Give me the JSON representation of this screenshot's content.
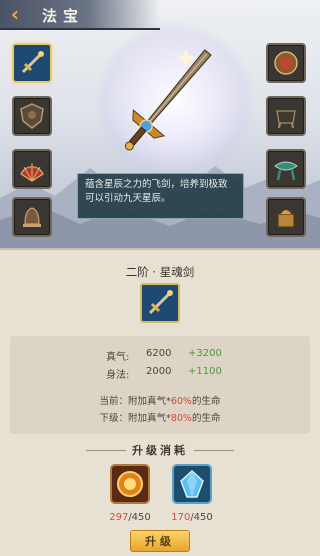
{
  "header": {
    "title": "法宝",
    "back_icon": "back-arrow-icon"
  },
  "left_slots": [
    {
      "name": "star-soul-sword",
      "icon": "sword-icon",
      "selected": true
    },
    {
      "name": "bronze-shield",
      "icon": "shield-icon",
      "selected": false
    },
    {
      "name": "red-fan",
      "icon": "fan-icon",
      "selected": false
    },
    {
      "name": "bronze-bell",
      "icon": "bell-icon",
      "selected": false
    }
  ],
  "right_slots": [
    {
      "name": "bronze-mirror",
      "icon": "mirror-icon"
    },
    {
      "name": "bronze-cauldron",
      "icon": "cauldron-icon"
    },
    {
      "name": "jade-ribbon",
      "icon": "ribbon-icon"
    },
    {
      "name": "bronze-seal",
      "icon": "seal-icon"
    }
  ],
  "description": "蕴含星辰之力的飞剑，培养到极致可以引动九天星辰。",
  "item": {
    "name": "二阶 · 星魂剑"
  },
  "stats": [
    {
      "label": "真气:",
      "value": "6200",
      "bonus": "+3200"
    },
    {
      "label": "身法:",
      "value": "2000",
      "bonus": "+1100"
    }
  ],
  "effects": {
    "current_prefix": "当前：附加真气*",
    "current_pct": "60%",
    "current_suffix": "的生命",
    "next_prefix": "下级：附加真气*",
    "next_pct": "80%",
    "next_suffix": "的生命"
  },
  "cost": {
    "title": "升级消耗",
    "materials": [
      {
        "name": "fire-orb",
        "icon": "fire-orb-icon",
        "have": "297",
        "need": "/450"
      },
      {
        "name": "blue-crystal",
        "icon": "blue-crystal-icon",
        "have": "170",
        "need": "/450"
      }
    ]
  },
  "upgrade_button": "升级",
  "colors": {
    "bonus_green": "#4c9a3e",
    "highlight_red": "#d64a3a",
    "button_gold": "#e8a62e",
    "selected_border": "#e8c86a"
  }
}
